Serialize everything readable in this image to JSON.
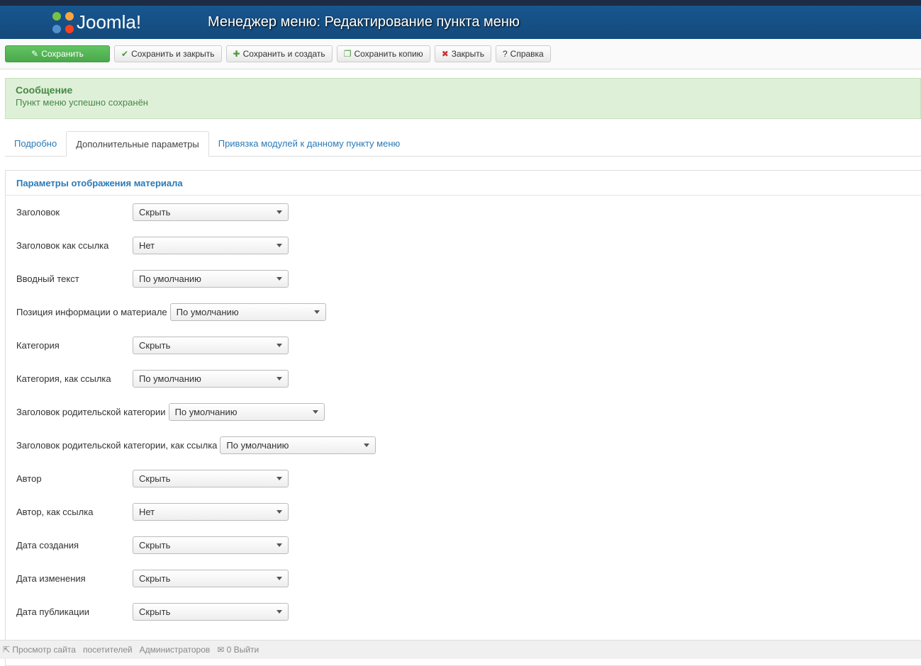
{
  "header": {
    "logo": "Joomla!",
    "title": "Менеджер меню: Редактирование пункта меню"
  },
  "toolbar": [
    {
      "label": "Сохранить",
      "icon": "✎",
      "name": "save-button"
    },
    {
      "label": "Сохранить и закрыть",
      "icon": "✔",
      "name": "save-close-button"
    },
    {
      "label": "Сохранить и создать",
      "icon": "✚",
      "name": "save-new-button"
    },
    {
      "label": "Сохранить копию",
      "icon": "❐",
      "name": "save-copy-button"
    },
    {
      "label": "Закрыть",
      "icon": "✖",
      "name": "close-button"
    },
    {
      "label": "Справка",
      "icon": "?",
      "name": "help-button"
    }
  ],
  "message": {
    "title": "Сообщение",
    "text": "Пункт меню успешно сохранён"
  },
  "tabs": [
    "Подробно",
    "Дополнительные параметры",
    "Привязка модулей к данному пункту меню"
  ],
  "panel": {
    "title": "Параметры отображения материала",
    "fields": [
      {
        "label": "Заголовок",
        "value": "Скрыть"
      },
      {
        "label": "Заголовок как ссылка",
        "value": "Нет"
      },
      {
        "label": "Вводный текст",
        "value": "По умолчанию"
      },
      {
        "label": "Позиция информации о материале",
        "value": "По умолчанию"
      },
      {
        "label": "Категория",
        "value": "Скрыть"
      },
      {
        "label": "Категория, как ссылка",
        "value": "По умолчанию"
      },
      {
        "label": "Заголовок родительской категории",
        "value": "По умолчанию"
      },
      {
        "label": "Заголовок родительской категории, как ссылка",
        "value": "По умолчанию"
      },
      {
        "label": "Автор",
        "value": "Скрыть"
      },
      {
        "label": "Автор, как ссылка",
        "value": "Нет"
      },
      {
        "label": "Дата создания",
        "value": "Скрыть"
      },
      {
        "label": "Дата изменения",
        "value": "Скрыть"
      },
      {
        "label": "Дата публикации",
        "value": "Скрыть"
      }
    ]
  },
  "status": {
    "view_site": "Просмотр сайта",
    "visitors": "посетителей",
    "admins": "Администраторов",
    "messages": "0",
    "logout": "Выйти"
  }
}
